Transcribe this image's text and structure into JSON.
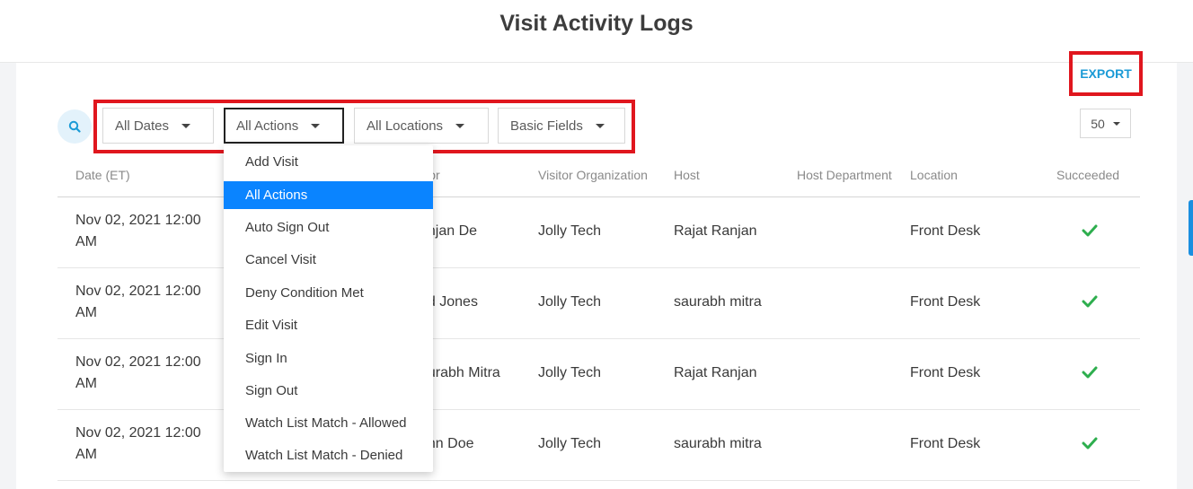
{
  "page": {
    "title": "Visit Activity Logs",
    "export_label": "EXPORT"
  },
  "filters": {
    "dates": "All Dates",
    "actions": "All Actions",
    "locations": "All Locations",
    "fields": "Basic Fields"
  },
  "per_page": "50",
  "table": {
    "headers": {
      "date": "Date (ET)",
      "visitor": "Visitor",
      "visitor_org": "Visitor Organization",
      "host": "Host",
      "host_dept": "Host Department",
      "location": "Location",
      "succeeded": "Succeeded"
    },
    "rows": [
      {
        "date_line1": "Nov 02, 2021 12:00",
        "date_line2": "AM",
        "visitor": "anjan De",
        "org": "Jolly Tech",
        "host": "Rajat Ranjan",
        "dept": "",
        "location": "Front Desk",
        "succeeded": true
      },
      {
        "date_line1": "Nov 02, 2021 12:00",
        "date_line2": "AM",
        "visitor": "ed Jones",
        "org": "Jolly Tech",
        "host": "saurabh mitra",
        "dept": "",
        "location": "Front Desk",
        "succeeded": true
      },
      {
        "date_line1": "Nov 02, 2021 12:00",
        "date_line2": "AM",
        "visitor": "aurabh Mitra",
        "org": "Jolly Tech",
        "host": "Rajat Ranjan",
        "dept": "",
        "location": "Front Desk",
        "succeeded": true
      },
      {
        "date_line1": "Nov 02, 2021 12:00",
        "date_line2": "AM",
        "visitor": "ohn Doe",
        "org": "Jolly Tech",
        "host": "saurabh mitra",
        "dept": "",
        "location": "Front Desk",
        "succeeded": true
      }
    ]
  },
  "actions_dropdown": {
    "selected": "All Actions",
    "options": [
      "Add Visit",
      "All Actions",
      "Auto Sign Out",
      "Cancel Visit",
      "Deny Condition Met",
      "Edit Visit",
      "Sign In",
      "Sign Out",
      "Watch List Match - Allowed",
      "Watch List Match - Denied"
    ]
  },
  "colors": {
    "accent": "#1a9ad6",
    "highlight": "#e0161e",
    "selected": "#0a84ff",
    "success": "#2eae4e"
  }
}
